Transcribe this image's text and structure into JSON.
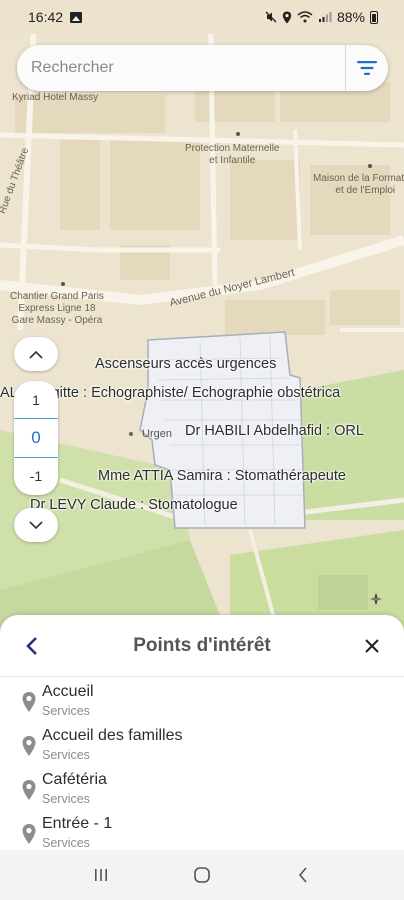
{
  "status_bar": {
    "time": "16:42",
    "battery": "88%"
  },
  "search": {
    "placeholder": "Rechercher"
  },
  "map_labels": {
    "hotel": "Kyriad Hotel Massy",
    "protection": "Protection Maternelle\net Infantile",
    "maison": "Maison de la Formation\net de l'Emploi",
    "rue_theatre": "Rue du Théâtre",
    "chantier": "Chantier Grand Paris\nExpress Ligne 18\nGare Massy - Opéra",
    "avenue": "Avenue du Noyer Lambert",
    "urgences": "Urgen"
  },
  "poi_labels": {
    "ascenseurs": "Ascenseurs accès urgences",
    "brigitte": "AL... Brigitte : Echographiste/ Echographie obstétrica",
    "habili": "Dr HABILI Abdelhafid : ORL",
    "attia": "Mme ATTIA Samira : Stomathérapeute",
    "levy": "Dr LEVY Claude : Stomatologue"
  },
  "levels": [
    "1",
    "0",
    "-1"
  ],
  "active_level": "0",
  "sheet": {
    "title": "Points d'intérêt",
    "items": [
      {
        "name": "Accueil",
        "category": "Services"
      },
      {
        "name": "Accueil des familles",
        "category": "Services"
      },
      {
        "name": "Cafétéria",
        "category": "Services"
      },
      {
        "name": "Entrée - 1",
        "category": "Services"
      }
    ]
  },
  "colors": {
    "accent": "#1f6fc9",
    "back_arrow": "#2a2f7a",
    "map_bg": "#ede4d0",
    "park": "#c7dba3",
    "building": "#e6dbc2",
    "hospital": "#eef0f5"
  }
}
